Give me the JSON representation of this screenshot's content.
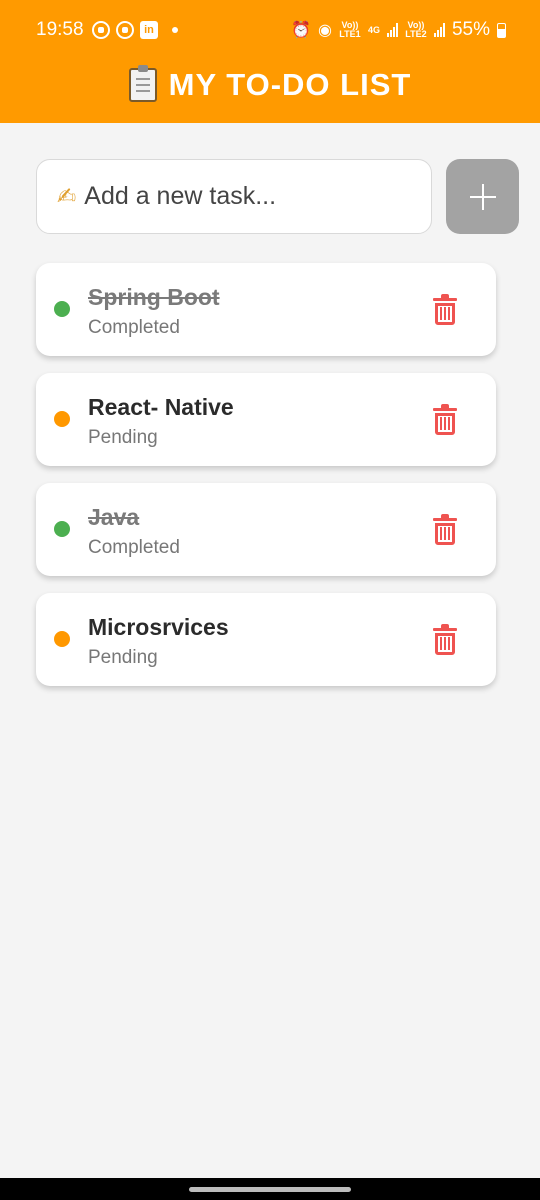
{
  "status_bar": {
    "time": "19:58",
    "battery": "55%",
    "icons": [
      "youtube-icon",
      "youtube-icon",
      "linkedin-icon",
      "alarm-icon",
      "hotspot-icon",
      "signal-icon",
      "battery-icon"
    ],
    "in_label": "in",
    "sim1_label": "Vo)) LTE1",
    "network_label": "4G",
    "sim2_label": "Vo)) LTE2"
  },
  "header": {
    "icon": "clipboard-icon",
    "title": "MY TO-DO LIST",
    "background": "#ff9a00"
  },
  "input": {
    "emoji": "✍",
    "placeholder": "Add a new task..."
  },
  "add_button": {
    "icon": "plus-icon"
  },
  "tasks": [
    {
      "title": "Spring Boot",
      "status": "Completed",
      "dot_color": "#4caf50",
      "done": true
    },
    {
      "title": "React- Native",
      "status": "Pending",
      "dot_color": "#ff9800",
      "done": false
    },
    {
      "title": "Java",
      "status": "Completed",
      "dot_color": "#4caf50",
      "done": true
    },
    {
      "title": "Microsrvices",
      "status": "Pending",
      "dot_color": "#ff9800",
      "done": false
    }
  ],
  "colors": {
    "accent": "#ff9a00",
    "completed": "#4caf50",
    "pending": "#ff9800",
    "delete": "#ef5350"
  }
}
